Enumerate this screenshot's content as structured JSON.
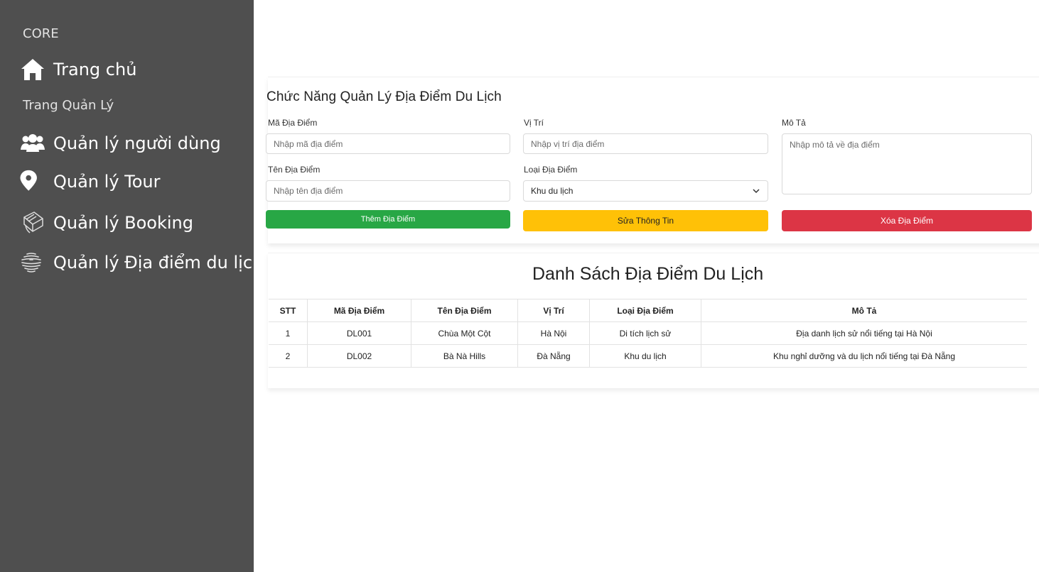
{
  "sidebar": {
    "section_core": "CORE",
    "home": "Trang chủ",
    "section_admin": "Trang Quản Lý",
    "users": "Quản lý người dùng",
    "tour": "Quản lý Tour",
    "booking": "Quản lý Booking",
    "places": "Quản lý Địa điểm du lịch",
    "icons": [
      "home-icon",
      "users-icon",
      "map-pin-icon",
      "book-icon",
      "globe-icon"
    ]
  },
  "form": {
    "title": "Chức Năng Quản Lý Địa Điểm Du Lịch",
    "code_label": "Mã Địa Điểm",
    "code_placeholder": "Nhập mã địa điểm",
    "location_label": "Vị Trí",
    "location_placeholder": "Nhập vị trí địa điểm",
    "desc_label": "Mô Tả",
    "desc_placeholder": "Nhập mô tả về địa điểm",
    "name_label": "Tên Địa Điểm",
    "name_placeholder": "Nhập tên địa điểm",
    "type_label": "Loại Địa Điểm",
    "type_value": "Khu du lịch",
    "add_button": "Thêm Địa Điểm",
    "edit_button": "Sửa Thông Tin",
    "delete_button": "Xóa Địa Điểm"
  },
  "list": {
    "title": "Danh Sách Địa Điểm Du Lịch",
    "headers": [
      "STT",
      "Mã Địa Điểm",
      "Tên Địa Điểm",
      "Vị Trí",
      "Loại Địa Điểm",
      "Mô Tả"
    ],
    "rows": [
      [
        "1",
        "DL001",
        "Chùa Một Cột",
        "Hà Nội",
        "Di tích lịch sử",
        "Địa danh lịch sử nổi tiếng tại Hà Nội"
      ],
      [
        "2",
        "DL002",
        "Bà Nà Hills",
        "Đà Nẵng",
        "Khu du lịch",
        "Khu nghỉ dưỡng và du lịch nổi tiếng tại Đà Nẵng"
      ]
    ]
  },
  "colors": {
    "sidebar_bg": "#4f4f4f",
    "add": "#28a745",
    "edit": "#ffc107",
    "delete": "#dc3545"
  }
}
